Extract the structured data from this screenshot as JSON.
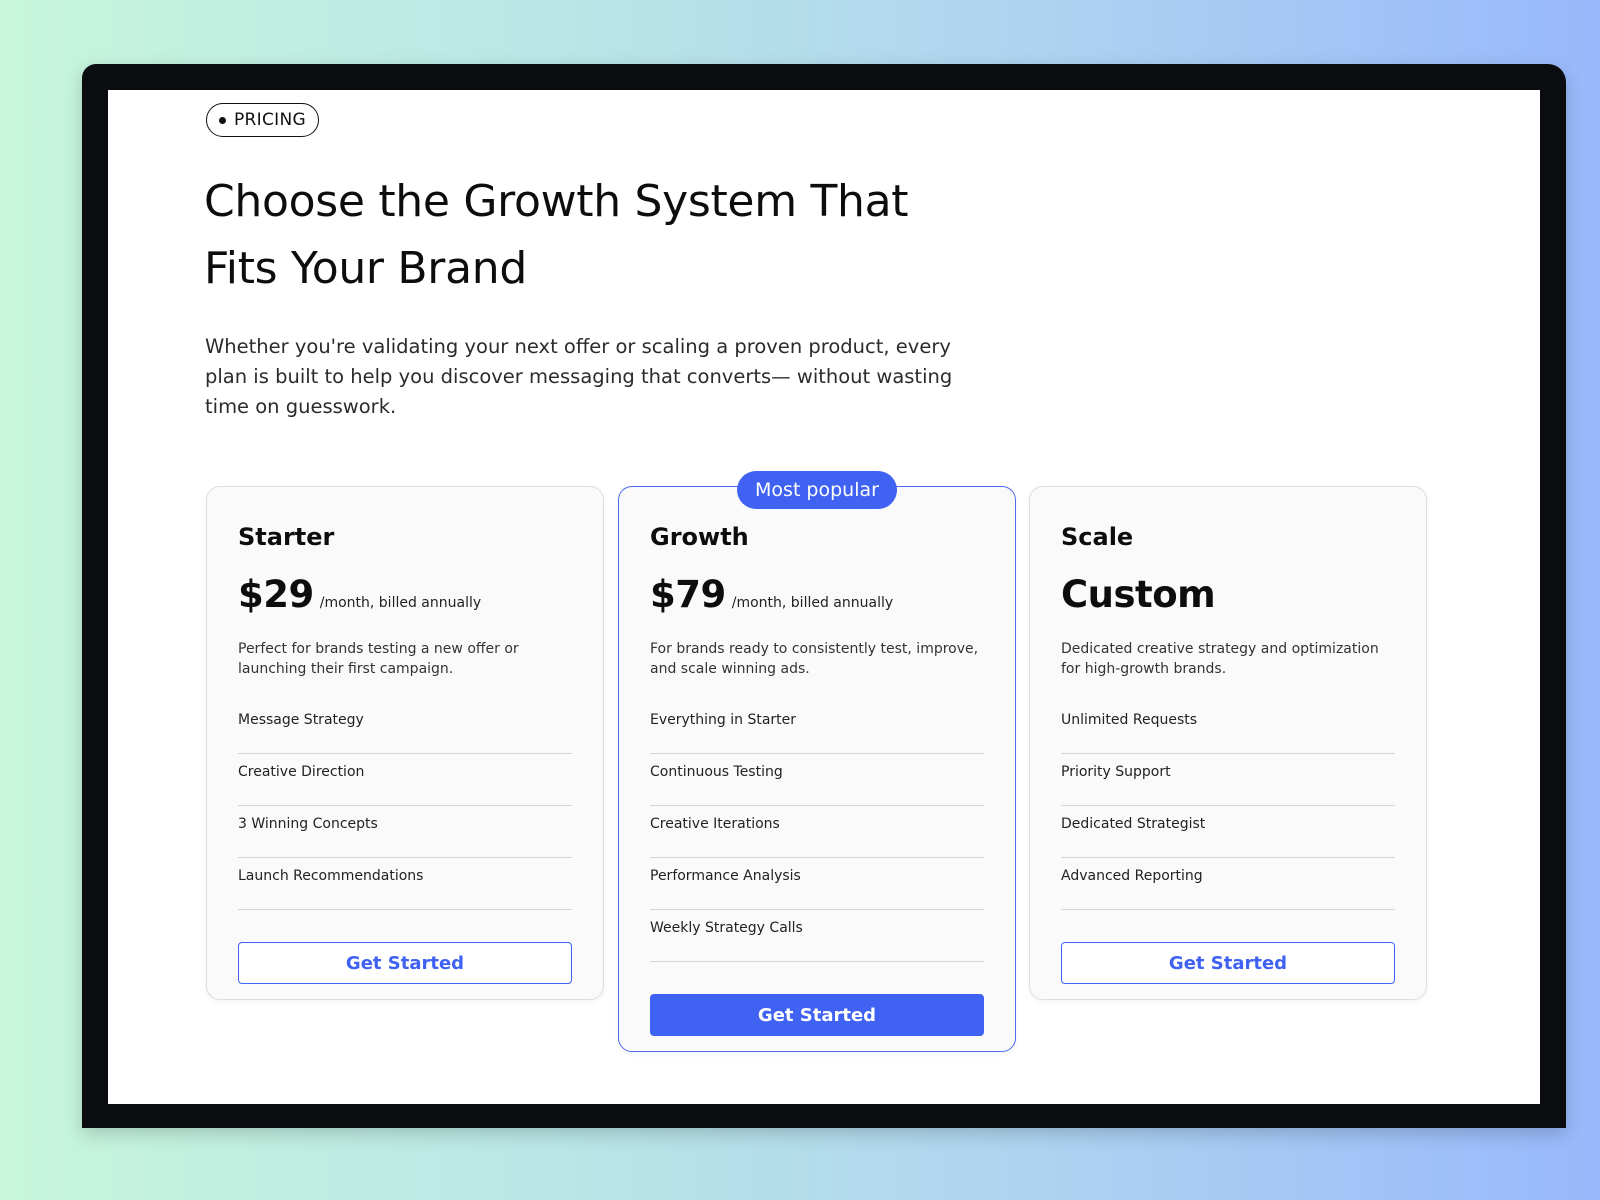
{
  "section_tag": "PRICING",
  "heading": "Choose the Growth System That Fits Your Brand",
  "subheading": "Whether you're validating your next offer or scaling a proven product, every plan is built to help you discover messaging that converts— without wasting time on guesswork.",
  "plans": [
    {
      "name": "Starter",
      "price": "$29",
      "period": "/month, billed annually",
      "description": "Perfect for brands testing a new offer or launching their first campaign.",
      "features": [
        "Message Strategy",
        "Creative Direction",
        "3 Winning Concepts",
        "Launch Recommendations"
      ],
      "cta": "Get Started"
    },
    {
      "name": "Growth",
      "badge": "Most popular",
      "price": "$79",
      "period": "/month, billed annually",
      "description": "For brands ready to consistently test, improve, and scale winning ads.",
      "features": [
        "Everything in Starter",
        "Continuous Testing",
        "Creative Iterations",
        "Performance Analysis",
        "Weekly Strategy Calls"
      ],
      "cta": "Get Started"
    },
    {
      "name": "Scale",
      "price": "Custom",
      "period": "",
      "description": "Dedicated creative strategy and optimization for high-growth brands.",
      "features": [
        "Unlimited Requests",
        "Priority Support",
        "Dedicated Strategist",
        "Advanced Reporting"
      ],
      "cta": "Get Started"
    }
  ],
  "colors": {
    "accent": "#3f62f2",
    "background_gradient_start": "#c7f6dc",
    "background_gradient_end": "#98b8fb",
    "frame": "#0b0c0f"
  }
}
